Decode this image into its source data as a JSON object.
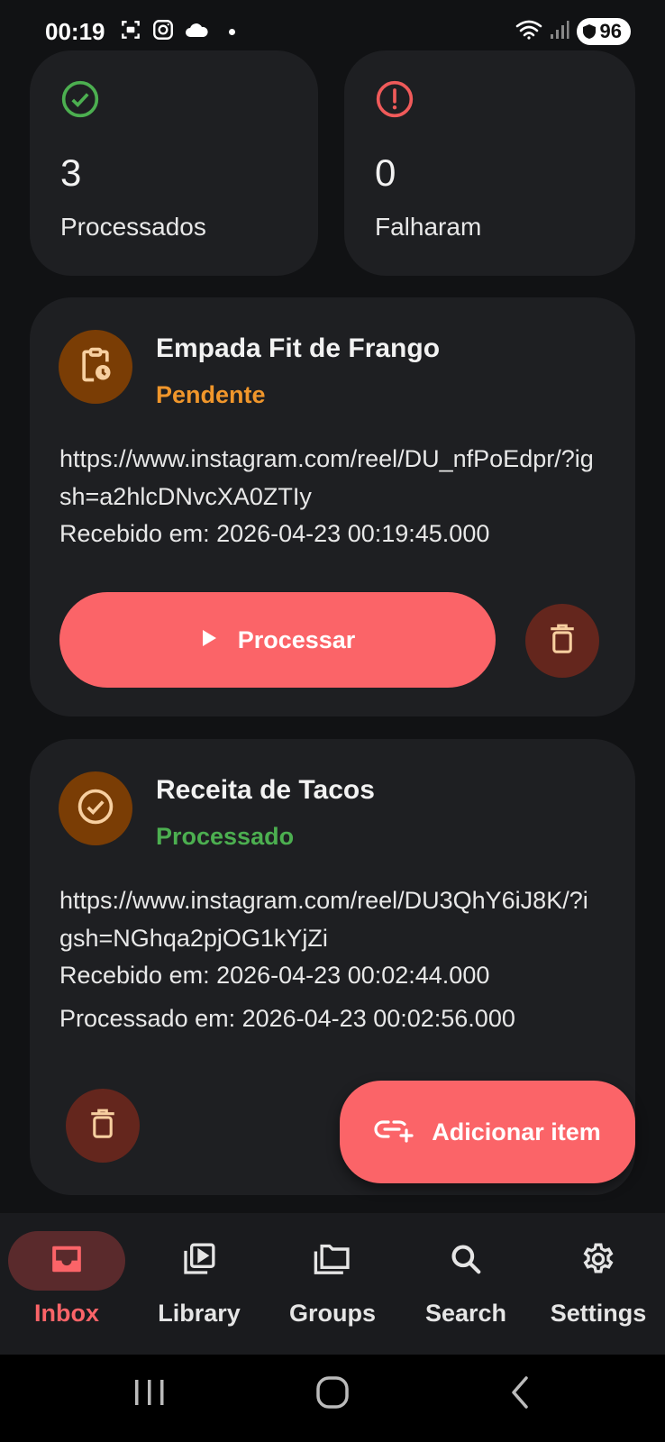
{
  "status_bar": {
    "time": "00:19",
    "battery": "96",
    "icons": [
      "screenshot-icon",
      "instagram-icon",
      "cloud-icon",
      "notification-dot",
      "wifi-icon",
      "signal-icon",
      "battery-icon"
    ]
  },
  "stats": {
    "processed": {
      "value": "3",
      "label": "Processados",
      "icon": "check-circle-icon",
      "color": "#4caf50"
    },
    "failed": {
      "value": "0",
      "label": "Falharam",
      "icon": "alert-circle-icon",
      "color": "#f05a5a"
    }
  },
  "items": [
    {
      "title": "Empada Fit de Frango",
      "status": "Pendente",
      "url": "https://www.instagram.com/reel/DU_nfPoEdpr/?igsh=a2hlcDNvcXA0ZTIy",
      "received": "Recebido em: 2026-04-23 00:19:45.000",
      "process_label": "Processar",
      "icon": "clipboard-clock-icon"
    },
    {
      "title": "Receita de Tacos",
      "status": "Processado",
      "url": "https://www.instagram.com/reel/DU3QhY6iJ8K/?igsh=NGhqa2pjOG1kYjZi",
      "received": "Recebido em: 2026-04-23 00:02:44.000",
      "processed": "Processado em: 2026-04-23 00:02:56.000",
      "icon": "check-circle-icon"
    }
  ],
  "fab": {
    "label": "Adicionar item",
    "icon": "link-add-icon"
  },
  "nav": [
    {
      "label": "Inbox",
      "icon": "inbox-icon",
      "active": true
    },
    {
      "label": "Library",
      "icon": "video-library-icon"
    },
    {
      "label": "Groups",
      "icon": "folders-icon"
    },
    {
      "label": "Search",
      "icon": "search-icon"
    },
    {
      "label": "Settings",
      "icon": "gear-icon"
    }
  ],
  "colors": {
    "accent": "#fb6468",
    "pending": "#f0962b",
    "success": "#4caf50",
    "card": "#1e1f22",
    "background": "#111214"
  }
}
